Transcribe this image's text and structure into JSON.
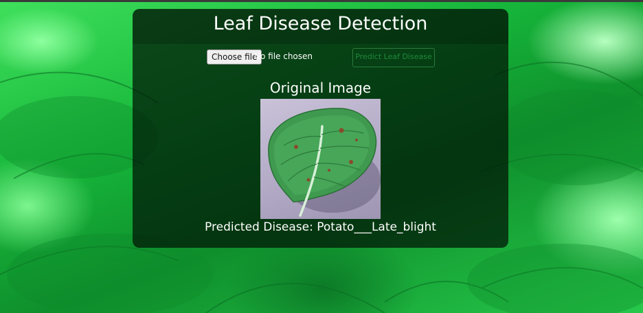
{
  "app": {
    "title": "Leaf Disease Detection"
  },
  "upload": {
    "choose_file_label": "Choose file",
    "file_status": "No file chosen",
    "predict_label": "Predict Leaf Disease"
  },
  "preview": {
    "heading": "Original Image"
  },
  "result": {
    "prefix": "Predicted Disease: ",
    "disease": "Potato___Late_blight"
  },
  "colors": {
    "background": "#1aa83a",
    "panel": "#001405",
    "predict_button_text": "#1f8a3a"
  }
}
